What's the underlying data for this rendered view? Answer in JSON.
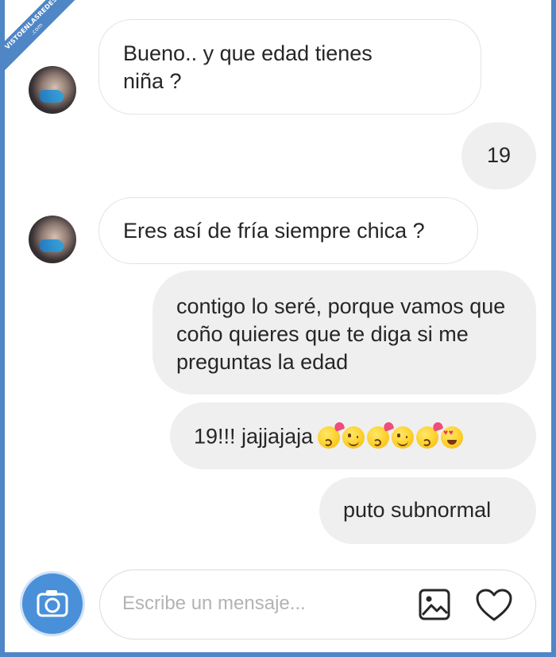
{
  "watermark": {
    "text": "VISTOENLASREDES",
    "sub": ".com"
  },
  "messages": [
    {
      "side": "in",
      "text": "Bueno.. y que edad tienes niña ?"
    },
    {
      "side": "out",
      "text": "19"
    },
    {
      "side": "in",
      "text": "Eres así de fría siempre chica ?"
    },
    {
      "side": "out",
      "text": "contigo lo seré, porque vamos que coño quieres que te diga si me preguntas la edad"
    },
    {
      "side": "out",
      "text": "19!!! jajjajaja",
      "emojis": [
        "kissing-face-with-heart",
        "smiling-face",
        "kissing-face-with-heart",
        "winking-face",
        "kissing-face-with-heart",
        "heart-eyes-face"
      ]
    },
    {
      "side": "out",
      "text": "puto subnormal"
    }
  ],
  "composer": {
    "placeholder": "Escribe un mensaje..."
  },
  "icons": {
    "camera": "camera-icon",
    "gallery": "image-gallery-icon",
    "like": "heart-icon"
  },
  "colors": {
    "accent": "#4a90d9",
    "outgoing_bubble": "#efefef",
    "incoming_border": "#e3e3e3",
    "frame": "#4f86c6"
  }
}
